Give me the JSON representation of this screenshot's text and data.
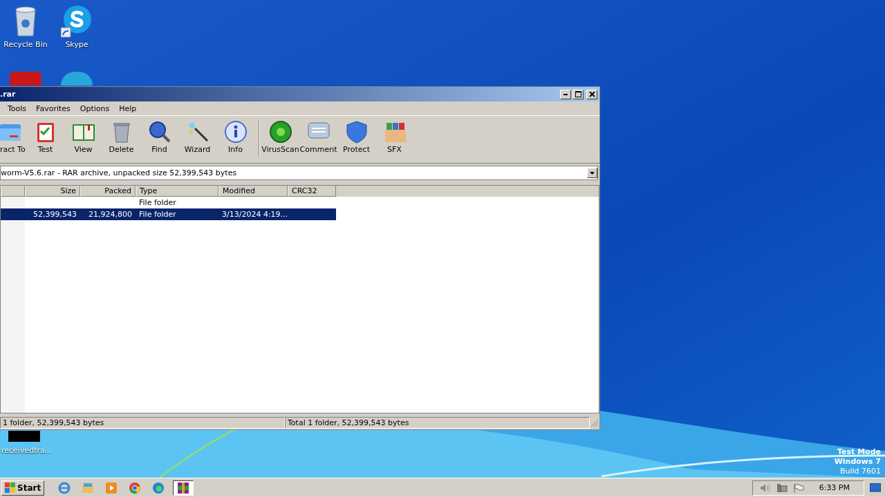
{
  "desktop_icons": [
    {
      "kind": "recycle-bin",
      "label": "Recycle Bin"
    },
    {
      "kind": "skype",
      "label": "Skype"
    }
  ],
  "desktop_file": {
    "label": "receivedtra..."
  },
  "window": {
    "title": ".rar",
    "menu": [
      "Tools",
      "Favorites",
      "Options",
      "Help"
    ],
    "toolbar": [
      {
        "kind": "extract",
        "label": "ract To"
      },
      {
        "kind": "test",
        "label": "Test"
      },
      {
        "kind": "view",
        "label": "View"
      },
      {
        "kind": "delete",
        "label": "Delete"
      },
      {
        "kind": "find",
        "label": "Find"
      },
      {
        "kind": "wizard",
        "label": "Wizard"
      },
      {
        "kind": "info",
        "label": "Info"
      },
      {
        "kind": "separator"
      },
      {
        "kind": "virusscan",
        "label": "VirusScan"
      },
      {
        "kind": "comment",
        "label": "Comment"
      },
      {
        "kind": "protect",
        "label": "Protect"
      },
      {
        "kind": "sfx",
        "label": "SFX"
      }
    ],
    "address": "worm-V5.6.rar - RAR archive, unpacked size 52,399,543 bytes",
    "columns": [
      "Size",
      "Packed",
      "Type",
      "Modified",
      "CRC32"
    ],
    "rows": [
      {
        "type": "File folder",
        "selected": false
      },
      {
        "size": "52,399,543",
        "packed": "21,924,800",
        "type": "File folder",
        "modified": "3/13/2024 4:19...",
        "selected": true
      }
    ],
    "status_bar": [
      "1 folder, 52,399,543 bytes",
      "Total 1 folder, 52,399,543 bytes"
    ]
  },
  "system_info": [
    "Test Mode",
    "Windows 7",
    "Build 7601"
  ],
  "taskbar": {
    "start": "Start",
    "apps": [
      {
        "kind": "ie",
        "selected": false
      },
      {
        "kind": "explorer",
        "selected": false
      },
      {
        "kind": "media",
        "selected": false
      },
      {
        "kind": "chrome",
        "selected": false
      },
      {
        "kind": "edge",
        "selected": false
      },
      {
        "kind": "winrar",
        "selected": true
      }
    ],
    "clock": "6:33 PM"
  }
}
